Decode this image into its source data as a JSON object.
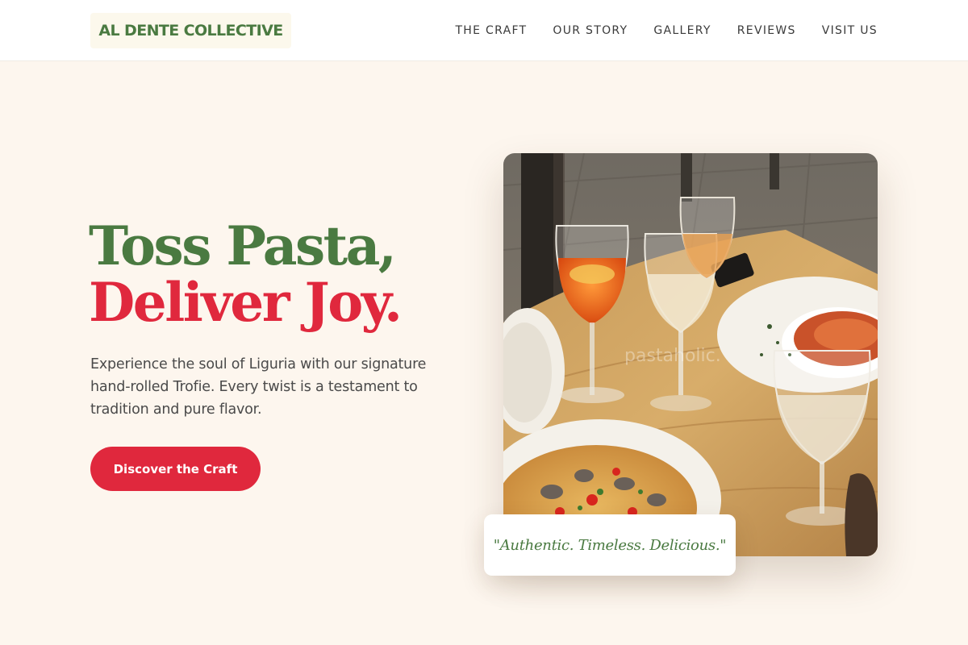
{
  "header": {
    "logo_text": "AL DENTE COLLECTIVE",
    "nav": [
      {
        "label": "THE CRAFT"
      },
      {
        "label": "OUR STORY"
      },
      {
        "label": "GALLERY"
      },
      {
        "label": "REVIEWS"
      },
      {
        "label": "VISIT US"
      }
    ]
  },
  "hero": {
    "headline_line1": "Toss Pasta,",
    "headline_line2": "Deliver Joy.",
    "description": "Experience the soul of Liguria with our signature hand-rolled Trofie. Every twist is a testament to tradition and pure flavor.",
    "cta_label": "Discover the Craft",
    "image_watermark": "pastaholic.",
    "quote": "\"Authentic. Timeless. Delicious.\""
  },
  "colors": {
    "background": "#fdf6ee",
    "brand_green": "#4a7a41",
    "accent_red": "#e0283d",
    "header_bg": "#ffffff"
  }
}
